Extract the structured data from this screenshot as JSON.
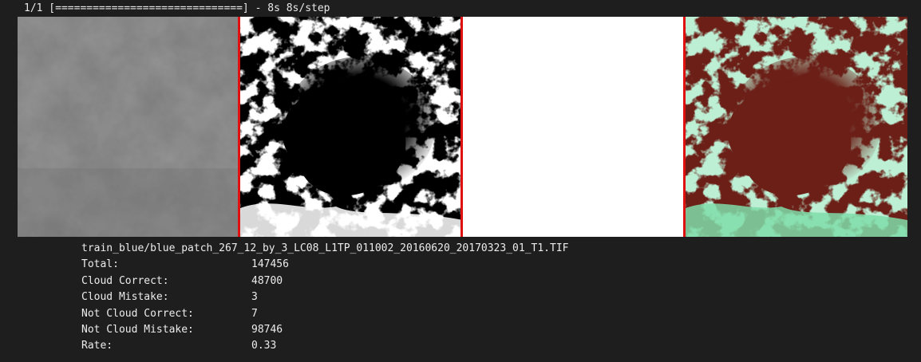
{
  "progress": {
    "text": "1/1 [==============================] - 8s 8s/step"
  },
  "colors": {
    "background": "#1e1e1e",
    "divider": "#e01010",
    "cloud_overlay": "#6b1f17",
    "clear_overlay": "#7fdca8",
    "mask_white": "#ffffff",
    "mask_black": "#000000",
    "grayscale_base": "#767676"
  },
  "panels": [
    {
      "name": "input-blue-band-image"
    },
    {
      "name": "predicted-cloud-mask"
    },
    {
      "name": "ground-truth-mask"
    },
    {
      "name": "overlay-comparison"
    }
  ],
  "stats": {
    "filename": "train_blue/blue_patch_267_12_by_3_LC08_L1TP_011002_20160620_20170323_01_T1.TIF",
    "rows": [
      {
        "label": "Total:",
        "value": "147456"
      },
      {
        "label": "Cloud Correct:",
        "value": "48700"
      },
      {
        "label": "Cloud Mistake:",
        "value": "3"
      },
      {
        "label": "Not Cloud Correct:",
        "value": "7"
      },
      {
        "label": "Not Cloud Mistake:",
        "value": "98746"
      },
      {
        "label": "Rate:",
        "value": "0.33"
      }
    ]
  }
}
